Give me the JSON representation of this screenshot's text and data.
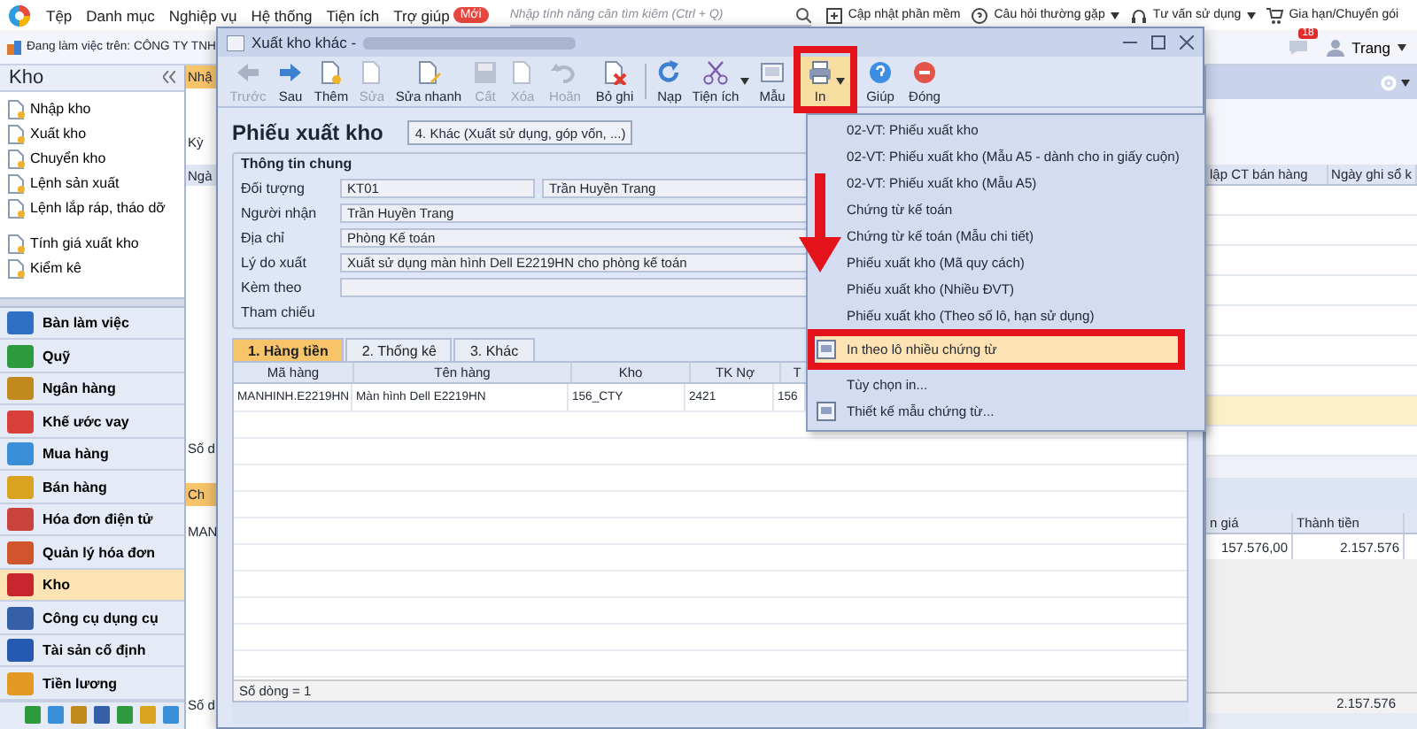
{
  "menubar": {
    "items": [
      "Tệp",
      "Danh mục",
      "Nghiệp vụ",
      "Hệ thống",
      "Tiện ích",
      "Trợ giúp"
    ],
    "badge": "Mới",
    "search": {
      "placeholder": "Nhập tính năng cần tìm kiếm (Ctrl + Q)"
    },
    "links": [
      {
        "label": "Cập nhật phần mềm",
        "has_menu": false
      },
      {
        "label": "Câu hỏi thường gặp",
        "has_menu": true
      },
      {
        "label": "Tư vấn sử dụng",
        "has_menu": true
      },
      {
        "label": "Gia hạn/Chuyển gói",
        "has_menu": false
      }
    ]
  },
  "workspace_bar": {
    "label": "Đang làm việc trên: CÔNG TY TNH",
    "notifications": "18",
    "user": "Trang"
  },
  "sidebar": {
    "title": "Kho",
    "item_groups": [
      [
        "Nhập kho",
        "Xuất kho",
        "Chuyển kho",
        "Lệnh sản xuất",
        "Lệnh lắp ráp, tháo dỡ"
      ],
      [
        "Tính giá xuất kho",
        "Kiểm kê"
      ]
    ],
    "modules": [
      {
        "label": "Bàn làm việc",
        "color": "#2f6fc4",
        "selected": false
      },
      {
        "label": "Quỹ",
        "color": "#2e9a3e",
        "selected": false
      },
      {
        "label": "Ngân hàng",
        "color": "#c08a1e",
        "selected": false
      },
      {
        "label": "Khế ước vay",
        "color": "#d8403a",
        "selected": false
      },
      {
        "label": "Mua hàng",
        "color": "#3a8fd8",
        "selected": false
      },
      {
        "label": "Bán hàng",
        "color": "#d9a21f",
        "selected": false
      },
      {
        "label": "Hóa đơn điện tử",
        "color": "#c8443c",
        "selected": false
      },
      {
        "label": "Quản lý hóa đơn",
        "color": "#d0552c",
        "selected": false
      },
      {
        "label": "Kho",
        "color": "#c8262e",
        "selected": true
      },
      {
        "label": "Công cụ dụng cụ",
        "color": "#3560a8",
        "selected": false
      },
      {
        "label": "Tài sản cố định",
        "color": "#2659b0",
        "selected": false
      },
      {
        "label": "Tiền lương",
        "color": "#e39a22",
        "selected": false
      }
    ]
  },
  "background_list": {
    "tab": "Nhậ",
    "period_label": "Kỳ",
    "column": "Ngà",
    "row_count": "Số d",
    "lower_tab": "Ch",
    "lower_cell": "MAN",
    "lower_row_count": "Số d"
  },
  "right_grid": {
    "columns": [
      "lập CT bán hàng",
      "Ngày ghi sổ k"
    ],
    "rows": [
      {
        "selected": false
      },
      {
        "selected": false
      },
      {
        "selected": false
      },
      {
        "selected": false
      },
      {
        "selected": false
      },
      {
        "selected": false
      },
      {
        "selected": false
      },
      {
        "selected": true
      },
      {
        "selected": false
      }
    ]
  },
  "right_detail": {
    "columns": [
      "n giá",
      "Thành tiền"
    ],
    "row": [
      "157.576,00",
      "2.157.576"
    ],
    "total": "2.157.576"
  },
  "dialog": {
    "title": "Xuất kho khác -",
    "toolbar": [
      {
        "label": "Trước",
        "disabled": true,
        "has_menu": false,
        "open": false
      },
      {
        "label": "Sau",
        "disabled": false,
        "has_menu": false,
        "open": false
      },
      {
        "label": "Thêm",
        "disabled": false,
        "has_menu": false,
        "open": false
      },
      {
        "label": "Sửa",
        "disabled": true,
        "has_menu": false,
        "open": false
      },
      {
        "label": "Sửa nhanh",
        "disabled": false,
        "has_menu": false,
        "open": false
      },
      {
        "label": "Cất",
        "disabled": true,
        "has_menu": false,
        "open": false
      },
      {
        "label": "Xóa",
        "disabled": true,
        "has_menu": false,
        "open": false
      },
      {
        "label": "Hoãn",
        "disabled": true,
        "has_menu": false,
        "open": false
      },
      {
        "label": "Bỏ ghi",
        "disabled": false,
        "has_menu": false,
        "open": false
      },
      {
        "label": "Nạp",
        "disabled": false,
        "has_menu": false,
        "open": false
      },
      {
        "label": "Tiện ích",
        "disabled": false,
        "has_menu": true,
        "open": false
      },
      {
        "label": "Mẫu",
        "disabled": false,
        "has_menu": false,
        "open": false
      },
      {
        "label": "In",
        "disabled": false,
        "has_menu": true,
        "open": true
      },
      {
        "label": "Giúp",
        "disabled": false,
        "has_menu": false,
        "open": false
      },
      {
        "label": "Đóng",
        "disabled": false,
        "has_menu": false,
        "open": false
      }
    ],
    "form_title": "Phiếu xuất kho",
    "voucher_type": "4. Khác (Xuất sử dụng, góp vốn, ...)",
    "group_title": "Thông tin chung",
    "fields": [
      {
        "label": "Đối tượng",
        "kind": "pair",
        "code": "KT01",
        "value": "Trần Huyền Trang"
      },
      {
        "label": "Người nhận",
        "kind": "text",
        "value": "Trần Huyền Trang"
      },
      {
        "label": "Địa chỉ",
        "kind": "text",
        "value": "Phòng Kế toán"
      },
      {
        "label": "Lý do xuất",
        "kind": "text",
        "value": "Xuất sử dụng màn hình Dell E2219HN cho phòng kế toán"
      },
      {
        "label": "Kèm theo",
        "kind": "blank"
      },
      {
        "label": "Tham chiếu",
        "kind": "label"
      }
    ],
    "tabs": [
      {
        "label": "1. Hàng tiền",
        "selected": true
      },
      {
        "label": "2. Thống kê",
        "selected": false
      },
      {
        "label": "3. Khác",
        "selected": false
      }
    ],
    "grid": {
      "columns": [
        "Mã hàng",
        "Tên hàng",
        "Kho",
        "TK Nợ",
        "T"
      ],
      "rows": [
        [
          "MANHINH.E2219HN",
          "Màn hình Dell E2219HN",
          "156_CTY",
          "2421",
          "156"
        ]
      ],
      "footer": "Số dòng = 1"
    }
  },
  "print_menu": [
    {
      "label": "02-VT: Phiếu xuất kho",
      "has_icon": false,
      "selected": false
    },
    {
      "label": "02-VT: Phiếu xuất kho (Mẫu A5 - dành cho in giấy cuộn)",
      "has_icon": false,
      "selected": false
    },
    {
      "label": "02-VT: Phiếu xuất kho (Mẫu A5)",
      "has_icon": false,
      "selected": false
    },
    {
      "label": "Chứng từ kế toán",
      "has_icon": false,
      "selected": false
    },
    {
      "label": "Chứng từ kế toán (Mẫu chi tiết)",
      "has_icon": false,
      "selected": false
    },
    {
      "label": "Phiếu xuất kho (Mã quy cách)",
      "has_icon": false,
      "selected": false
    },
    {
      "label": "Phiếu xuất kho (Nhiều ĐVT)",
      "has_icon": false,
      "selected": false
    },
    {
      "label": "Phiếu xuất kho (Theo số lô, hạn sử dụng)",
      "has_icon": false,
      "selected": false
    },
    {
      "label": "In theo lô nhiều chứng từ",
      "has_icon": true,
      "selected": true
    },
    {
      "label": "Tùy chọn in...",
      "has_icon": false,
      "selected": false
    },
    {
      "label": "Thiết kế mẫu chứng từ...",
      "has_icon": true,
      "selected": false
    }
  ]
}
